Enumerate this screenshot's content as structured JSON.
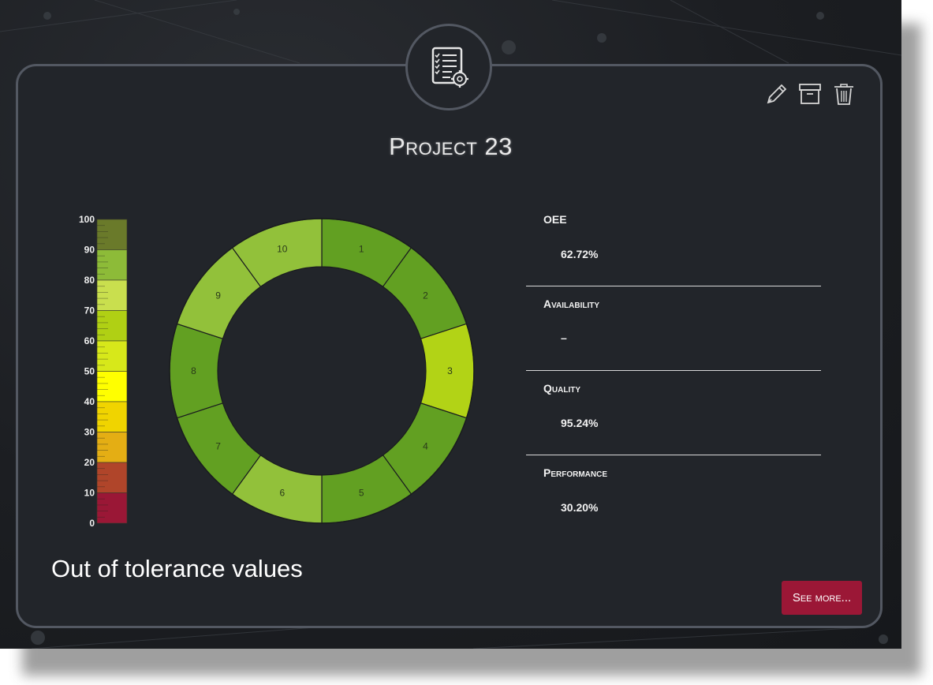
{
  "card": {
    "title": "Project 23",
    "badge_icon": "settings-list-icon"
  },
  "toolbar": {
    "edit_icon": "pencil-icon",
    "archive_icon": "archive-icon",
    "delete_icon": "trash-icon"
  },
  "gauge": {
    "ticks": [
      "100",
      "90",
      "80",
      "70",
      "60",
      "50",
      "40",
      "30",
      "20",
      "10",
      "0"
    ],
    "band_colors": [
      "#6a7a2a",
      "#8dbb38",
      "#c9df4e",
      "#b0d014",
      "#d7e81a",
      "#ffff00",
      "#f0d400",
      "#e4ae14",
      "#b0452a",
      "#9a1736"
    ]
  },
  "chart_data": {
    "type": "donut",
    "segments": [
      "1",
      "2",
      "3",
      "4",
      "5",
      "6",
      "7",
      "8",
      "9",
      "10"
    ],
    "colors": [
      "#62a022",
      "#62a022",
      "#b2d316",
      "#62a022",
      "#62a022",
      "#92c13a",
      "#62a022",
      "#62a022",
      "#92c13a",
      "#92c13a"
    ]
  },
  "metrics": [
    {
      "label": "OEE",
      "value": "62.72%"
    },
    {
      "label": "Availability",
      "value": "–"
    },
    {
      "label": "Quality",
      "value": "95.24%"
    },
    {
      "label": "Performance",
      "value": "30.20%"
    }
  ],
  "footer": {
    "out_of_tolerance": "Out of tolerance values",
    "see_more": "See more..."
  }
}
